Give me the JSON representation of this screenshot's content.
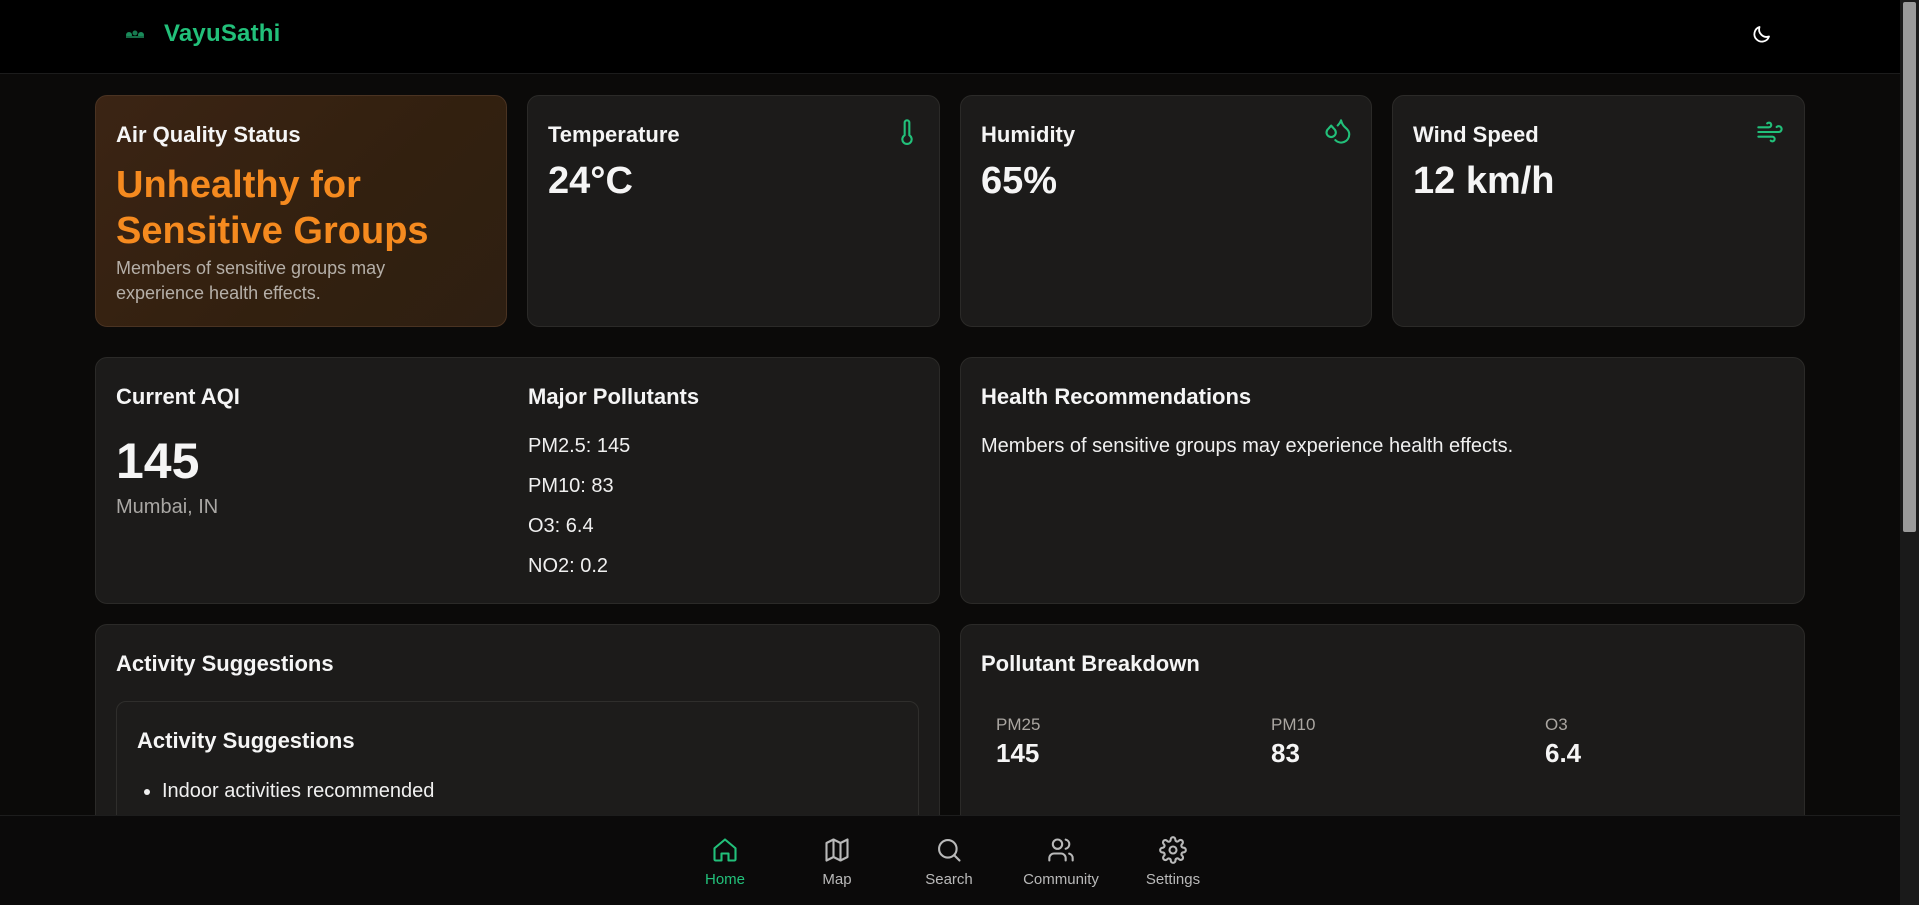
{
  "app": {
    "brand": "VayuSathi"
  },
  "colors": {
    "accent": "#22c07a",
    "warning": "#f58a1f"
  },
  "status_card": {
    "title": "Air Quality Status",
    "status": "Unhealthy for Sensitive Groups",
    "description": "Members of sensitive groups may experience health effects."
  },
  "weather": {
    "temperature": {
      "label": "Temperature",
      "value": "24°C",
      "icon": "thermometer-icon"
    },
    "humidity": {
      "label": "Humidity",
      "value": "65%",
      "icon": "droplets-icon"
    },
    "wind": {
      "label": "Wind Speed",
      "value": "12 km/h",
      "icon": "wind-icon"
    }
  },
  "aqi": {
    "title": "Current AQI",
    "value": "145",
    "location": "Mumbai, IN",
    "pollutants_title": "Major Pollutants",
    "pollutants": [
      "PM2.5: 145",
      "PM10: 83",
      "O3: 6.4",
      "NO2: 0.2"
    ]
  },
  "health": {
    "title": "Health Recommendations",
    "text": "Members of sensitive groups may experience health effects."
  },
  "activities": {
    "title": "Activity Suggestions",
    "inner_title": "Activity Suggestions",
    "items": [
      "Indoor activities recommended"
    ]
  },
  "breakdown": {
    "title": "Pollutant Breakdown",
    "items": [
      {
        "label": "PM25",
        "value": "145"
      },
      {
        "label": "PM10",
        "value": "83"
      },
      {
        "label": "O3",
        "value": "6.4"
      }
    ]
  },
  "nav": {
    "items": [
      {
        "label": "Home",
        "icon": "home-icon",
        "active": true
      },
      {
        "label": "Map",
        "icon": "map-icon",
        "active": false
      },
      {
        "label": "Search",
        "icon": "search-icon",
        "active": false
      },
      {
        "label": "Community",
        "icon": "users-icon",
        "active": false
      },
      {
        "label": "Settings",
        "icon": "gear-icon",
        "active": false
      }
    ]
  }
}
